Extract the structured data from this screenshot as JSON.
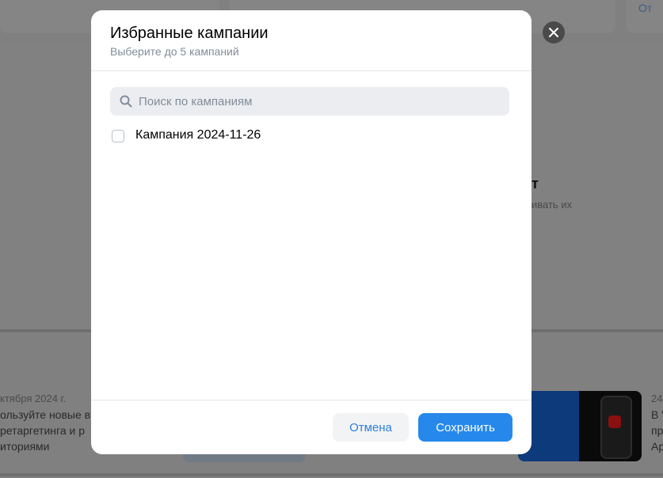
{
  "background": {
    "top_right_link": "От",
    "heading_fragment": "т",
    "text_fragment": "ивать их",
    "news_date_left": "ктября 2024 г.",
    "news_lines_left": [
      "ользуйте новые в",
      "ретаргетинга и р",
      "иториями"
    ],
    "news_date_right": "24",
    "news_lines_right": [
      "В V",
      "пр",
      "Ар"
    ]
  },
  "modal": {
    "title": "Избранные кампании",
    "subtitle": "Выберите до 5 кампаний",
    "search": {
      "placeholder": "Поиск по кампаниям",
      "value": ""
    },
    "items": [
      {
        "label": "Кампания 2024-11-26",
        "checked": false
      }
    ],
    "footer": {
      "cancel_label": "Отмена",
      "save_label": "Сохранить"
    }
  },
  "colors": {
    "accent": "#2688eb",
    "overlay": "#808080",
    "secondary_text": "#818c99"
  }
}
